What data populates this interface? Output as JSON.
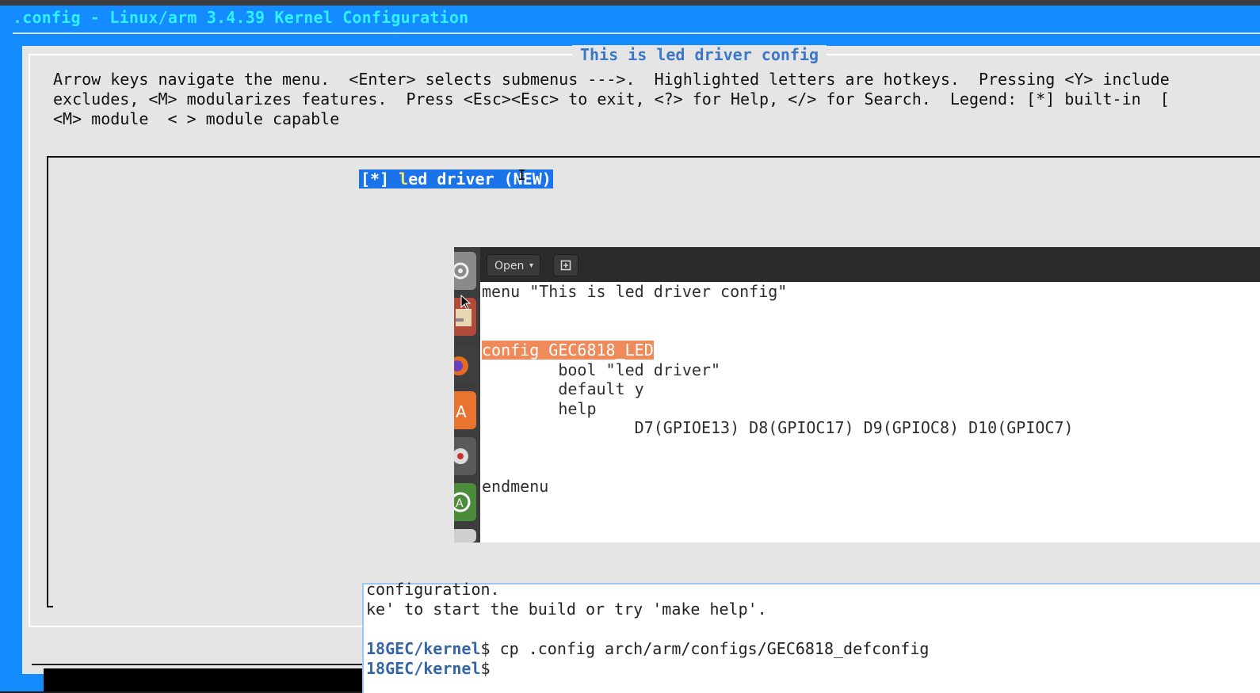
{
  "window": {
    "title": ".config - Linux/arm 3.4.39 Kernel Configuration"
  },
  "dialog": {
    "title": "This is led driver config",
    "help_lines": [
      "Arrow keys navigate the menu.  <Enter> selects submenus --->.  Highlighted letters are hotkeys.  Pressing <Y> include",
      "excludes, <M> modularizes features.  Press <Esc><Esc> to exit, <?> for Help, </> for Search.  Legend: [*] built-in  [",
      "<M> module  < > module capable"
    ],
    "menu_item": {
      "prefix": "[*] ",
      "hotkey": "l",
      "rest": "ed driver (NEW)"
    }
  },
  "gedit": {
    "open_label": "Open",
    "open_caret": "▾",
    "new_tab_icon": "new-document-icon",
    "code_lines": [
      "menu \"This is led driver config\"",
      "",
      "",
      "config GEC6818_LED",
      "        bool \"led driver\"",
      "        default y",
      "        help",
      "                D7(GPIOE13) D8(GPIOC17) D9(GPIOC8) D10(GPIOC7)",
      "",
      "",
      "endmenu"
    ],
    "launcher_icons": [
      "settings-icon",
      "files-icon",
      "firefox-icon",
      "software-center-icon",
      "system-tools-icon",
      "update-icon",
      "trash-icon"
    ]
  },
  "terminal": {
    "lines": [
      {
        "prompt": "",
        "text": "configuration."
      },
      {
        "prompt": "",
        "text": "ke' to start the build or try 'make help'."
      },
      {
        "prompt": "",
        "text": ""
      },
      {
        "prompt": "18GEC/kernel",
        "text": "$ cp .config arch/arm/configs/GEC6818_defconfig"
      },
      {
        "prompt": "18GEC/kernel",
        "text": "$"
      }
    ]
  },
  "colors": {
    "terminal_bg": "#148cff",
    "title_text": "#2ff1ff",
    "dialog_bg": "#e5e5e5",
    "selection_bg": "#1a73e8",
    "hotkey": "#f7e76a",
    "code_highlight": "#ef8b5b",
    "prompt": "#3465a4"
  }
}
